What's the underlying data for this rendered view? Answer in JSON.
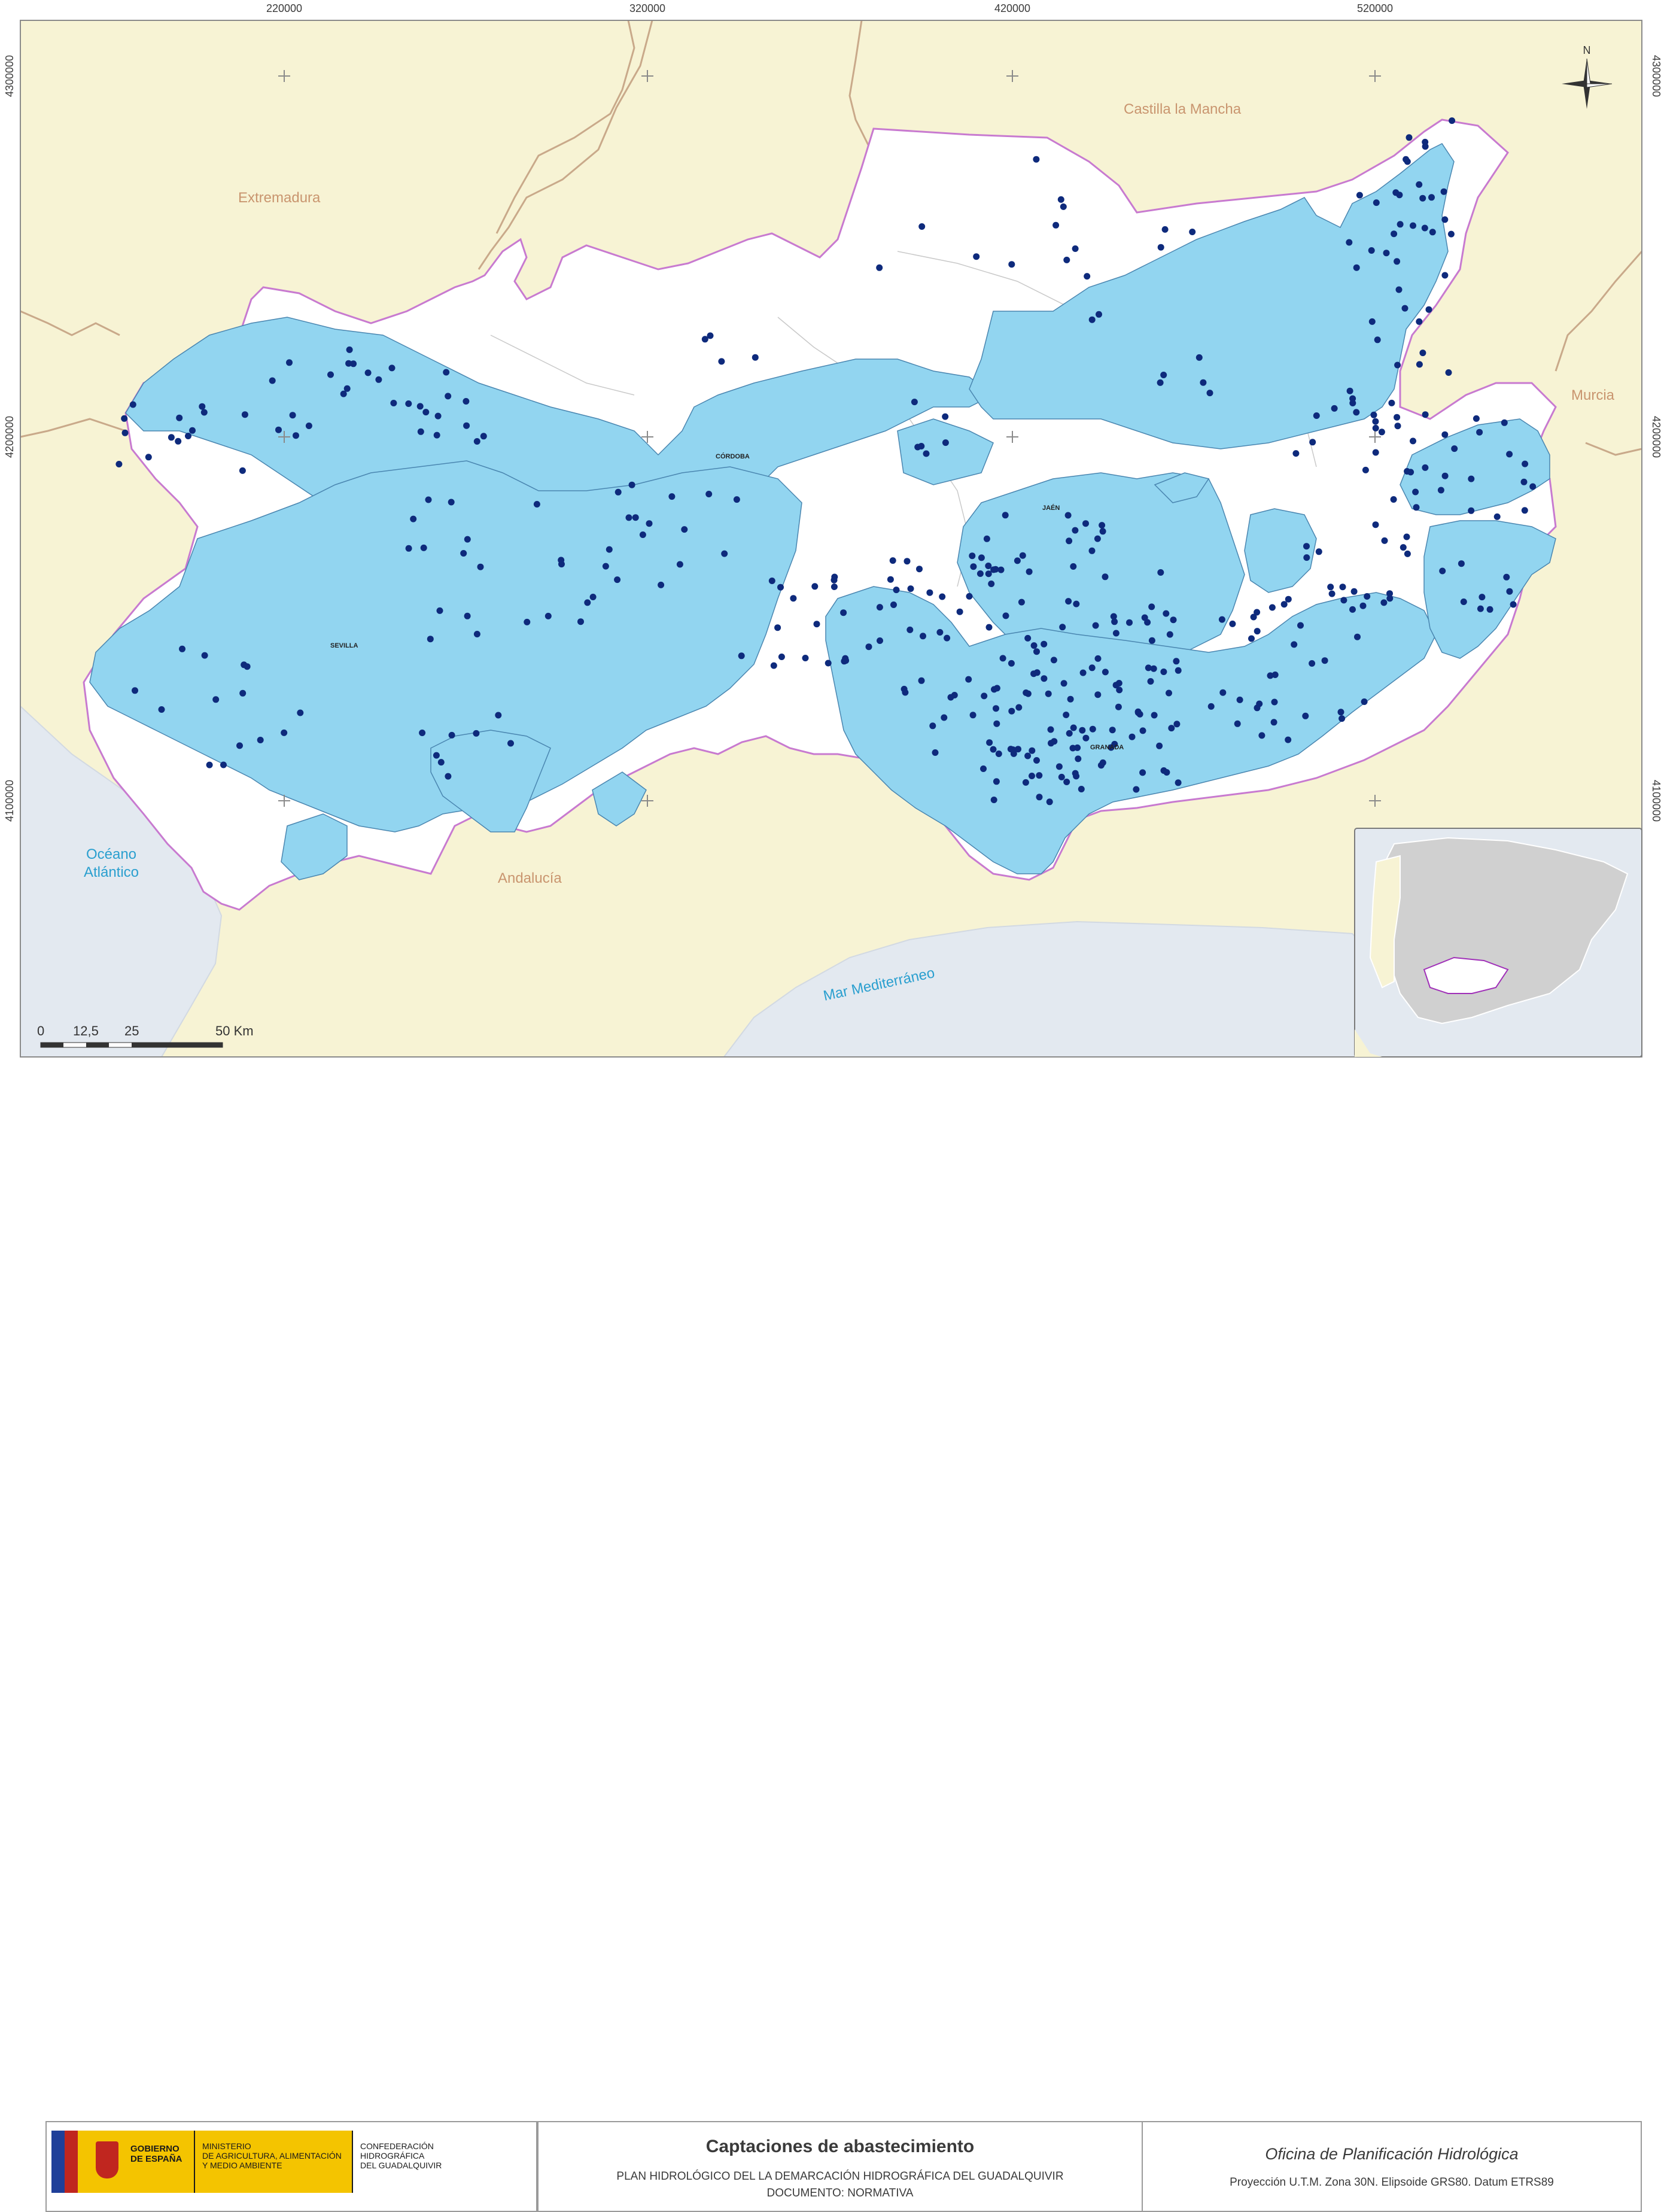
{
  "map": {
    "grid_labels": {
      "x": [
        "220000",
        "320000",
        "420000",
        "520000"
      ],
      "y": [
        "4300000",
        "4200000",
        "4100000"
      ]
    },
    "regions": {
      "castilla": "Castilla la Mancha",
      "extremadura": "Extremadura",
      "murcia": "Murcia",
      "andalucia": "Andalucía"
    },
    "seas": {
      "atlantic_1": "Océano",
      "atlantic_2": "Atlántico",
      "mediterranean": "Mar Mediterráneo"
    },
    "cities": {
      "cordoba": "CÓRDOBA",
      "sevilla": "SEVILLA",
      "granada": "GRANADA",
      "jaen": "JAÉN"
    },
    "north_arrow": "N",
    "scale_bar": [
      "0",
      "12,5",
      "25",
      "50 Km"
    ],
    "colors": {
      "basin_fill": "#92d5f0",
      "basin_border": "#c87ad0",
      "neighbor_fill": "#f7f3d4",
      "sea_fill": "#e3e9f0",
      "point": "#0e2a7c",
      "land_white": "#ffffff"
    },
    "legend_symbols": [
      "abastecimiento-point-icon"
    ]
  },
  "footer": {
    "gov_1": "GOBIERNO",
    "gov_2": "DE ESPAÑA",
    "ministry_1": "MINISTERIO",
    "ministry_2": "DE AGRICULTURA, ALIMENTACIÓN",
    "ministry_3": "Y MEDIO AMBIENTE",
    "conf_1": "CONFEDERACIÓN",
    "conf_2": "HIDROGRÁFICA",
    "conf_3": "DEL GUADALQUIVIR",
    "title": "Captaciones de abastecimiento",
    "subtitle_1": "PLAN HIDROLÓGICO DEL LA DEMARCACIÓN HIDROGRÁFICA DEL GUADALQUIVIR",
    "subtitle_2": "DOCUMENTO: NORMATIVA",
    "office": "Oficina de Planificación Hidrológica",
    "projection": "Proyección U.T.M. Zona 30N. Elipsoide GRS80. Datum ETRS89"
  }
}
